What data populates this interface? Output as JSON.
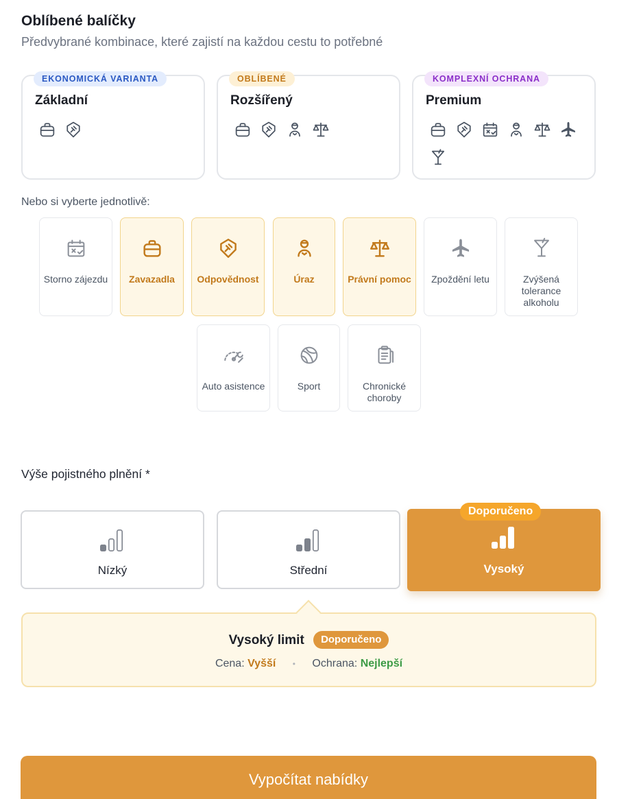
{
  "header": {
    "title": "Oblíbené balíčky",
    "subtitle": "Předvybrané kombinace, které zajistí na každou cestu to potřebné"
  },
  "packages": [
    {
      "badge": "EKONOMICKÁ VARIANTA",
      "name": "Základní",
      "icons": [
        "luggage-icon",
        "shield-gavel-icon"
      ],
      "badge_color": "#2b59c3",
      "badge_bg": "#e3ecfd"
    },
    {
      "badge": "OBLÍBENÉ",
      "name": "Rozšířený",
      "icons": [
        "luggage-icon",
        "shield-gavel-icon",
        "injured-person-icon",
        "scales-icon"
      ],
      "badge_color": "#c27a1c",
      "badge_bg": "#fdf0d5"
    },
    {
      "badge": "KOMPLEXNÍ OCHRANA",
      "name": "Premium",
      "icons": [
        "luggage-icon",
        "shield-gavel-icon",
        "calendar-cancel-icon",
        "injured-person-icon",
        "scales-icon",
        "airplane-icon",
        "cocktail-icon"
      ],
      "badge_color": "#8b2fc9",
      "badge_bg": "#f3e4fb"
    }
  ],
  "individual_label": "Nebo si vyberte jednotlivě:",
  "options": [
    {
      "label": "Storno zájezdu",
      "icon": "calendar-cancel-icon",
      "selected": false
    },
    {
      "label": "Zavazadla",
      "icon": "luggage-icon",
      "selected": true
    },
    {
      "label": "Odpovědnost",
      "icon": "shield-gavel-icon",
      "selected": true
    },
    {
      "label": "Úraz",
      "icon": "injured-person-icon",
      "selected": true
    },
    {
      "label": "Právní pomoc",
      "icon": "scales-icon",
      "selected": true
    },
    {
      "label": "Zpoždění letu",
      "icon": "airplane-icon",
      "selected": false
    },
    {
      "label": "Zvýšená tolerance alkoholu",
      "icon": "cocktail-icon",
      "selected": false
    },
    {
      "label": "Auto asistence",
      "icon": "car-wrench-icon",
      "selected": false
    },
    {
      "label": "Sport",
      "icon": "ball-icon",
      "selected": false
    },
    {
      "label": "Chronické choroby",
      "icon": "clipboard-icon",
      "selected": false
    }
  ],
  "limit_section": {
    "label": "Výše pojistného plnění *",
    "levels": [
      {
        "label": "Nízký",
        "bars_filled": 1,
        "selected": false
      },
      {
        "label": "Střední",
        "bars_filled": 2,
        "selected": false
      },
      {
        "label": "Vysoký",
        "bars_filled": 3,
        "selected": true
      }
    ],
    "recommended_badge": "Doporučeno"
  },
  "summary": {
    "title": "Vysoký limit",
    "badge": "Doporučeno",
    "price_label": "Cena:",
    "price_value": "Vyšší",
    "protection_label": "Ochrana:",
    "protection_value": "Nejlepší"
  },
  "cta": {
    "label": "Vypočítat nabídky"
  },
  "colors": {
    "accent": "#df973c",
    "selected_tile_bg": "#fef7e6",
    "icon_gray": "#6b7280"
  }
}
